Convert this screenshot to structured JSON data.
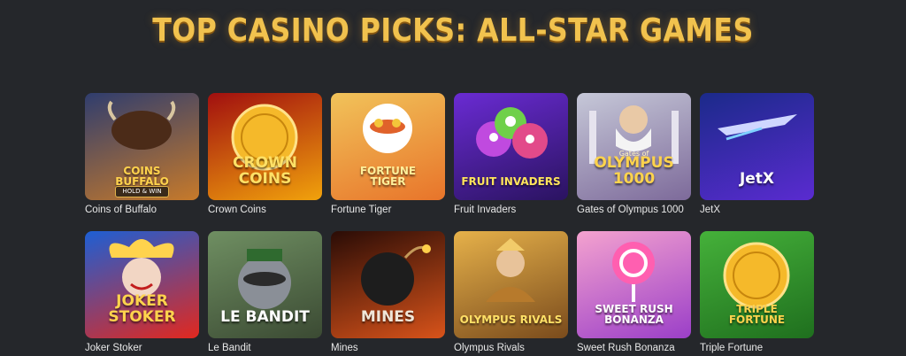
{
  "page": {
    "title": "TOP CASINO PICKS: ALL-STAR GAMES"
  },
  "games": [
    {
      "name": "Coins of Buffalo",
      "thumb_text": "COINS\nBUFFALO",
      "badge": "HOLD & WIN",
      "icon": "buffalo-icon",
      "colors": [
        "#2f3d6e",
        "#c77a2a"
      ],
      "text_color": "#ffd34d"
    },
    {
      "name": "Crown Coins",
      "thumb_text": "CROWN\nCOINS",
      "icon": "coin-icon",
      "colors": [
        "#a10f0f",
        "#f1a20c"
      ],
      "text_color": "#ffe066"
    },
    {
      "name": "Fortune Tiger",
      "thumb_text": "FORTUNE\nTIGER",
      "icon": "tiger-icon",
      "colors": [
        "#f1c35a",
        "#e8742a"
      ],
      "text_color": "#ffef9a"
    },
    {
      "name": "Fruit Invaders",
      "thumb_text": "FRUIT INVADERS",
      "icon": "alien-icon",
      "colors": [
        "#6a2bd3",
        "#2a1360"
      ],
      "text_color": "#ffe45c"
    },
    {
      "name": "Gates of Olympus 1000",
      "thumb_text": "OLYMPUS\n1000",
      "caption": "Gates of",
      "icon": "zeus-icon",
      "colors": [
        "#c6c8d8",
        "#7d6a9a"
      ],
      "text_color": "#ffd34d"
    },
    {
      "name": "JetX",
      "thumb_text": "JetX",
      "icon": "jet-icon",
      "colors": [
        "#1b2a8a",
        "#5a2bd0"
      ],
      "text_color": "#ffffff"
    },
    {
      "name": "Joker Stoker",
      "thumb_text": "JOKER STOKER",
      "icon": "joker-icon",
      "colors": [
        "#1d5fd4",
        "#e2281e"
      ],
      "text_color": "#ffd34d"
    },
    {
      "name": "Le Bandit",
      "thumb_text": "LE BANDIT",
      "icon": "raccoon-icon",
      "colors": [
        "#6f8f62",
        "#3b4a33"
      ],
      "text_color": "#ffffff"
    },
    {
      "name": "Mines",
      "thumb_text": "MINES",
      "icon": "bomb-icon",
      "colors": [
        "#2a0c06",
        "#d8531a"
      ],
      "text_color": "#f0e6d8"
    },
    {
      "name": "Olympus Rivals",
      "thumb_text": "OLYMPUS RIVALS",
      "icon": "warrior-icon",
      "colors": [
        "#e6b14a",
        "#7a4b1c"
      ],
      "text_color": "#ffe066"
    },
    {
      "name": "Sweet Rush Bonanza",
      "thumb_text": "SWEET RUSH\nBONANZA",
      "icon": "lollipop-icon",
      "colors": [
        "#f4a2cf",
        "#9b3fc8"
      ],
      "text_color": "#ffffff"
    },
    {
      "name": "Triple Fortune",
      "thumb_text": "TRIPLE\nFORTUNE",
      "icon": "coin-icon",
      "colors": [
        "#45b13a",
        "#1f6f1e"
      ],
      "text_color": "#ffd34d"
    }
  ]
}
